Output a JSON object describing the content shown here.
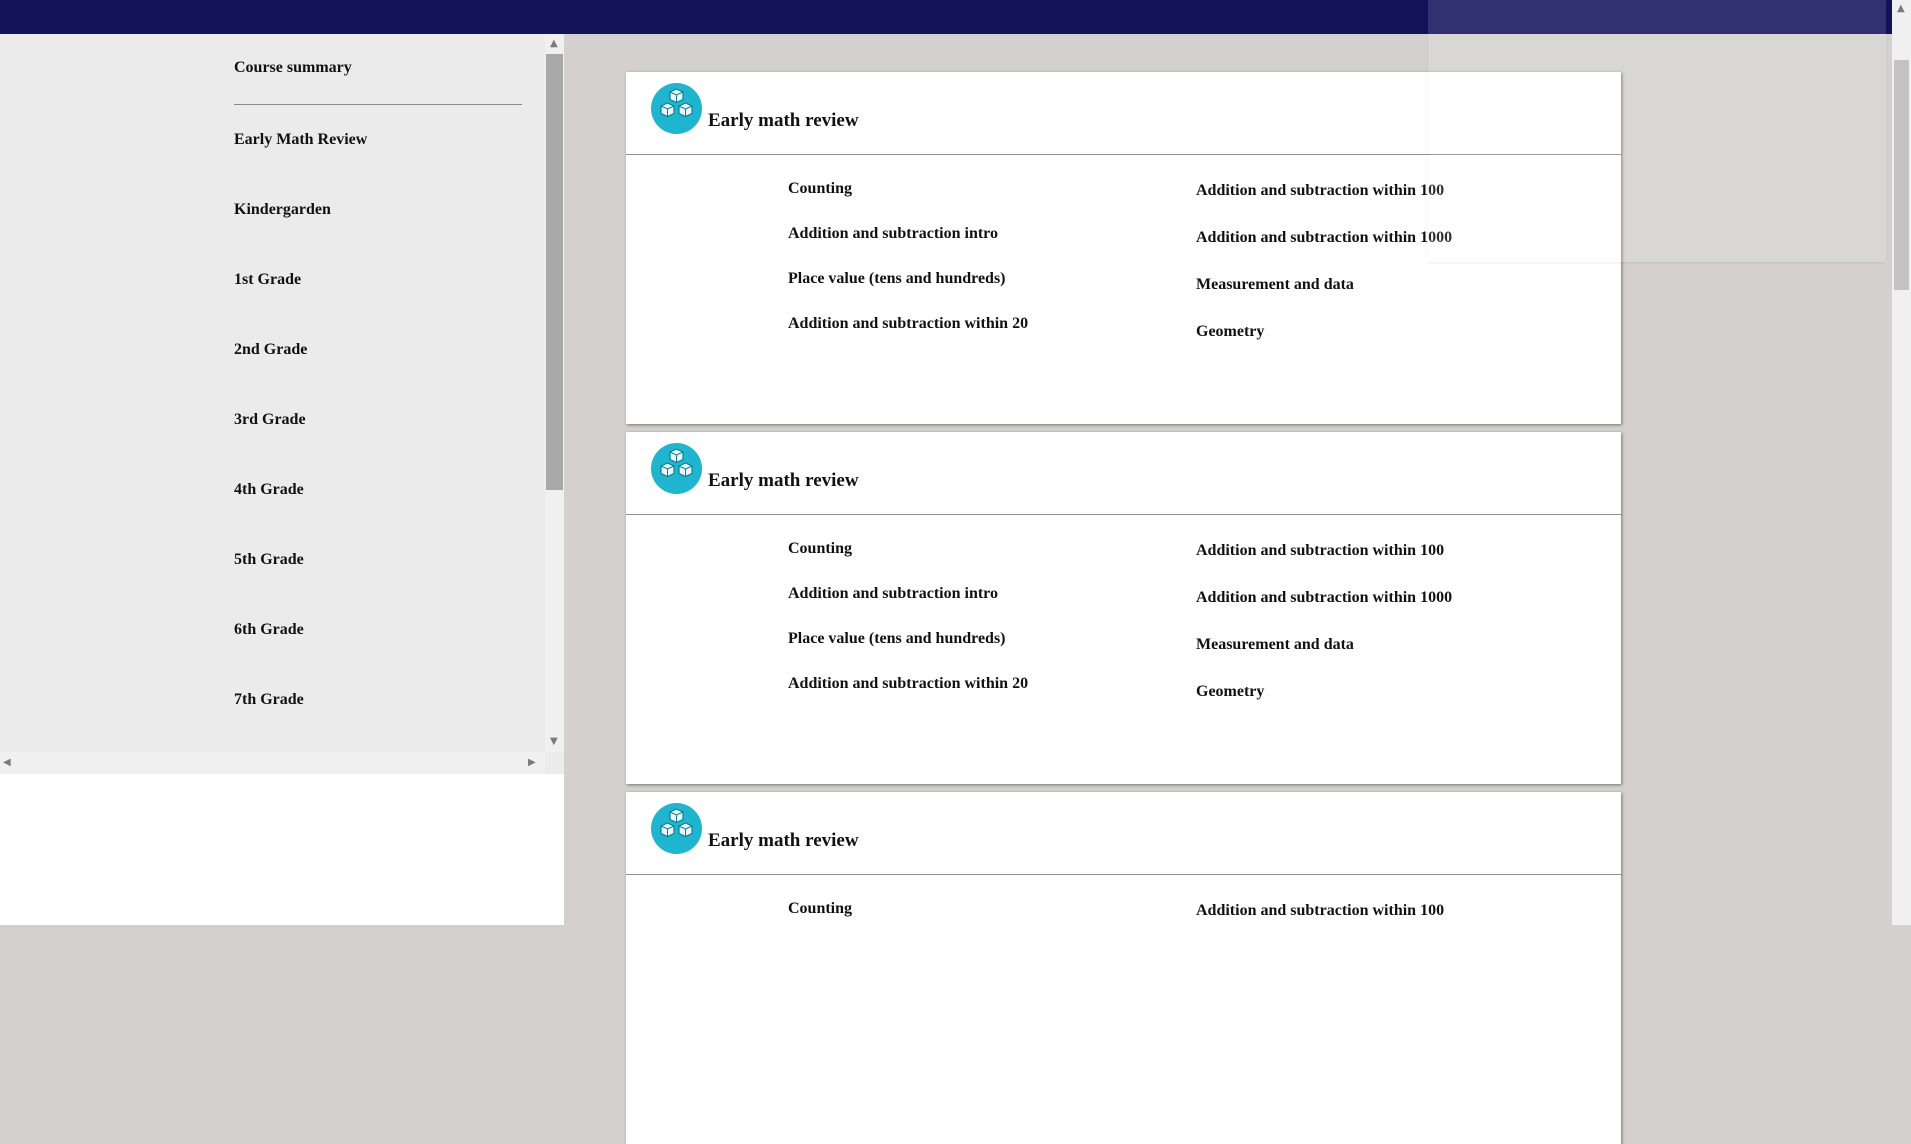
{
  "sidebar": {
    "header_item": "Course summary",
    "items": [
      {
        "label": "Early Math Review"
      },
      {
        "label": "Kindergarden"
      },
      {
        "label": "1st Grade"
      },
      {
        "label": "2nd Grade"
      },
      {
        "label": "3rd Grade"
      },
      {
        "label": "4th Grade"
      },
      {
        "label": "5th Grade"
      },
      {
        "label": "6th Grade"
      },
      {
        "label": "7th Grade"
      }
    ]
  },
  "cards": [
    {
      "title": "Early math review",
      "icon": "cubes-icon",
      "left_topics": [
        "Counting",
        "Addition and subtraction intro",
        "Place value (tens and hundreds)",
        "Addition and subtraction within 20"
      ],
      "right_topics": [
        "Addition and subtraction within 100",
        "Addition and subtraction within 1000",
        "Measurement and data",
        "Geometry"
      ]
    },
    {
      "title": "Early math review",
      "icon": "cubes-icon",
      "left_topics": [
        "Counting",
        "Addition and subtraction intro",
        "Place value (tens and hundreds)",
        "Addition and subtraction within 20"
      ],
      "right_topics": [
        "Addition and subtraction within 100",
        "Addition and subtraction within 1000",
        "Measurement and data",
        "Geometry"
      ]
    },
    {
      "title": "Early math review",
      "icon": "cubes-icon",
      "left_topics": [
        "Counting"
      ],
      "right_topics": [
        "Addition and subtraction within 100"
      ]
    }
  ],
  "colors": {
    "topbar": "#13135a",
    "badge": "#1fb5cf",
    "sidebar_bg": "#ebebeb",
    "main_bg": "#d4d0d0"
  }
}
